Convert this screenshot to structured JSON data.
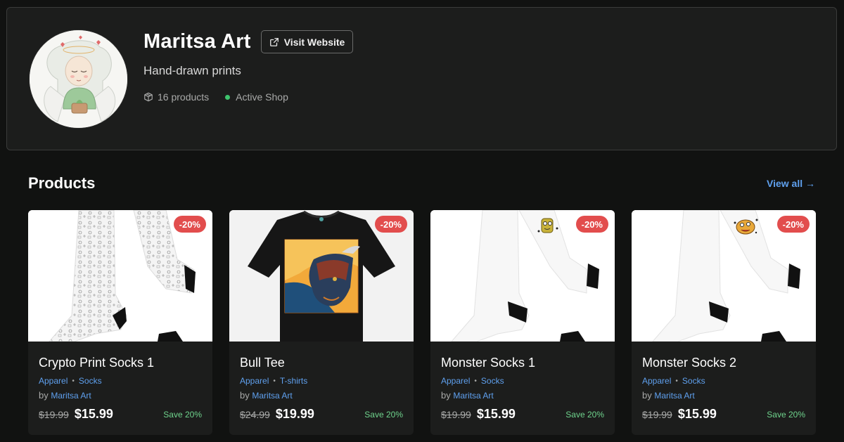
{
  "shop": {
    "name": "Maritsa Art",
    "visit_label": "Visit Website",
    "tagline": "Hand-drawn prints",
    "product_count": "16 products",
    "status": "Active Shop"
  },
  "section": {
    "title": "Products",
    "view_all": "View all →"
  },
  "products": [
    {
      "title": "Crypto Print Socks 1",
      "category": "Apparel",
      "subcategory": "Socks",
      "by": "by",
      "vendor": "Maritsa Art",
      "old_price": "$19.99",
      "price": "$15.99",
      "discount": "-20%",
      "save": "Save 20%"
    },
    {
      "title": "Bull Tee",
      "category": "Apparel",
      "subcategory": "T-shirts",
      "by": "by",
      "vendor": "Maritsa Art",
      "old_price": "$24.99",
      "price": "$19.99",
      "discount": "-20%",
      "save": "Save 20%"
    },
    {
      "title": "Monster Socks 1",
      "category": "Apparel",
      "subcategory": "Socks",
      "by": "by",
      "vendor": "Maritsa Art",
      "old_price": "$19.99",
      "price": "$15.99",
      "discount": "-20%",
      "save": "Save 20%"
    },
    {
      "title": "Monster Socks 2",
      "category": "Apparel",
      "subcategory": "Socks",
      "by": "by",
      "vendor": "Maritsa Art",
      "old_price": "$19.99",
      "price": "$15.99",
      "discount": "-20%",
      "save": "Save 20%"
    }
  ],
  "colors": {
    "background": "#111211",
    "card": "#1c1d1c",
    "accent_link": "#5fa0ee",
    "discount_badge": "#e24d4d",
    "save_text": "#6fd48d",
    "status_active": "#3ec46d"
  },
  "icons": [
    "external-link-icon",
    "box-icon",
    "status-dot",
    "arrow-right"
  ]
}
